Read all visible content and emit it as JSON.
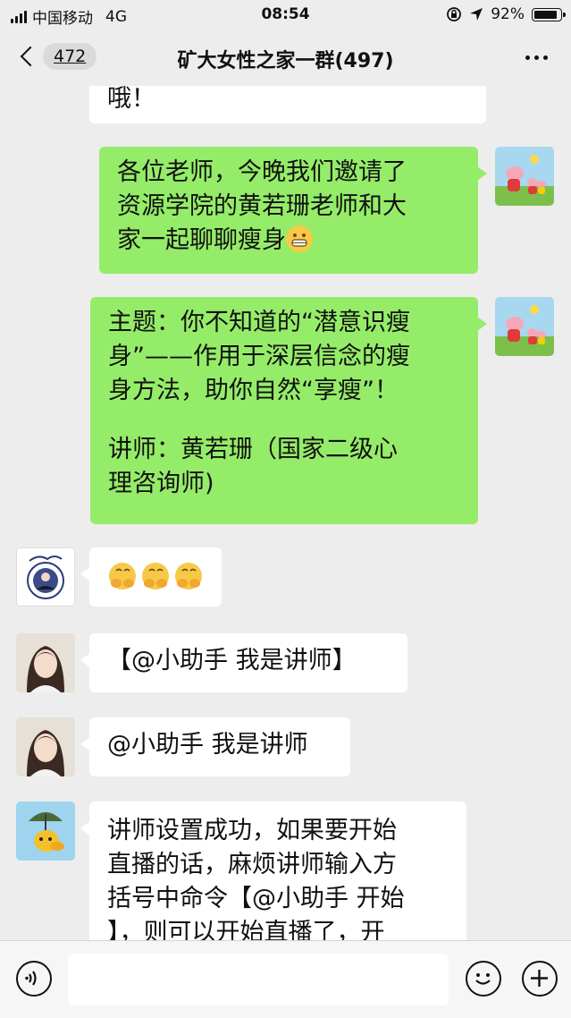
{
  "status_bar": {
    "carrier": "中国移动",
    "network": "4G",
    "time": "08:54",
    "battery": "92%",
    "battery_level": 0.92
  },
  "nav": {
    "unread_count": "472",
    "title": "矿大女性之家一群(497)"
  },
  "messages": [
    {
      "side": "left",
      "text": "哦！"
    },
    {
      "side": "right",
      "lines": [
        "各位老师，今晚我们邀请了",
        "资源学院的黄若珊老师和大",
        "家一起聊聊瘦身"
      ],
      "emoji": "grin-emoji"
    },
    {
      "side": "right",
      "lines": [
        "主题：你不知道的“潜意识瘦",
        "身”——作用于深层信念的瘦",
        "身方法，助你自然“享瘦”！",
        "",
        "讲师：黄若珊（国家二级心",
        "理咨询师)"
      ]
    },
    {
      "side": "left",
      "emoji": "hands-over-mouth-emoji ×3"
    },
    {
      "side": "left",
      "text": "【@小助手 我是讲师】"
    },
    {
      "side": "left",
      "text": "@小助手 我是讲师"
    },
    {
      "side": "left",
      "lines": [
        "讲师设置成功，如果要开始",
        "直播的话，麻烦讲师输入方",
        "括号中命令【@小助手 开始",
        "】，则可以开始直播了，开"
      ]
    }
  ],
  "input_bar": {
    "placeholder": ""
  },
  "colors": {
    "background": "#ededed",
    "own_bubble": "#95ec69",
    "other_bubble": "#ffffff"
  }
}
